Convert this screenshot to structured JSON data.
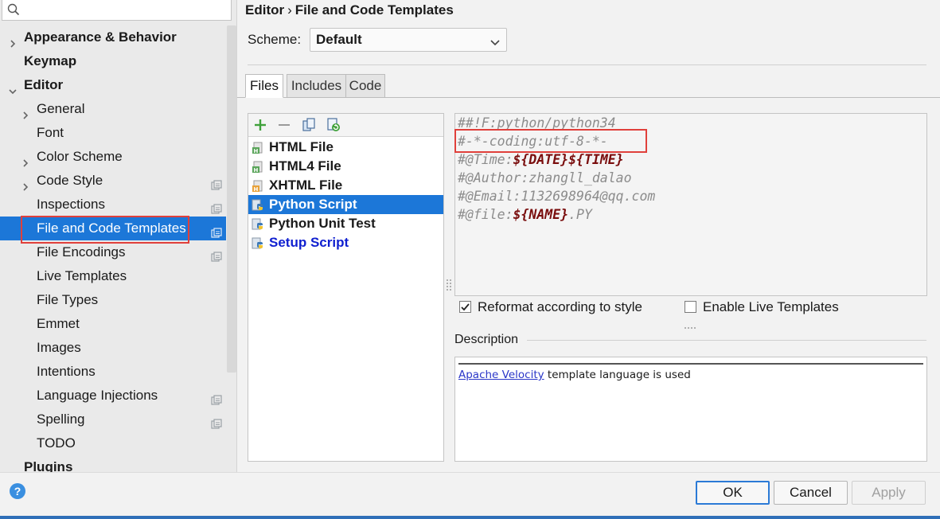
{
  "search": {
    "placeholder": ""
  },
  "sidebar": {
    "items": [
      {
        "label": "Appearance & Behavior",
        "level": 0,
        "bold": true,
        "expand": "collapsed",
        "scope": false
      },
      {
        "label": "Keymap",
        "level": 0,
        "bold": true,
        "expand": "none",
        "scope": false
      },
      {
        "label": "Editor",
        "level": 0,
        "bold": true,
        "expand": "expanded",
        "scope": false
      },
      {
        "label": "General",
        "level": 1,
        "bold": false,
        "expand": "collapsed",
        "scope": false
      },
      {
        "label": "Font",
        "level": 1,
        "bold": false,
        "expand": "none",
        "scope": false
      },
      {
        "label": "Color Scheme",
        "level": 1,
        "bold": false,
        "expand": "collapsed",
        "scope": false
      },
      {
        "label": "Code Style",
        "level": 1,
        "bold": false,
        "expand": "collapsed",
        "scope": true
      },
      {
        "label": "Inspections",
        "level": 1,
        "bold": false,
        "expand": "none",
        "scope": true
      },
      {
        "label": "File and Code Templates",
        "level": 1,
        "bold": false,
        "expand": "none",
        "scope": true,
        "selected": true
      },
      {
        "label": "File Encodings",
        "level": 1,
        "bold": false,
        "expand": "none",
        "scope": true
      },
      {
        "label": "Live Templates",
        "level": 1,
        "bold": false,
        "expand": "none",
        "scope": false
      },
      {
        "label": "File Types",
        "level": 1,
        "bold": false,
        "expand": "none",
        "scope": false
      },
      {
        "label": "Emmet",
        "level": 1,
        "bold": false,
        "expand": "none",
        "scope": false
      },
      {
        "label": "Images",
        "level": 1,
        "bold": false,
        "expand": "none",
        "scope": false
      },
      {
        "label": "Intentions",
        "level": 1,
        "bold": false,
        "expand": "none",
        "scope": false
      },
      {
        "label": "Language Injections",
        "level": 1,
        "bold": false,
        "expand": "none",
        "scope": true
      },
      {
        "label": "Spelling",
        "level": 1,
        "bold": false,
        "expand": "none",
        "scope": true
      },
      {
        "label": "TODO",
        "level": 1,
        "bold": false,
        "expand": "none",
        "scope": false
      },
      {
        "label": "Plugins",
        "level": 0,
        "bold": true,
        "expand": "none",
        "scope": false
      }
    ]
  },
  "header": {
    "breadcrumb_parent": "Editor",
    "breadcrumb_sep": "›",
    "breadcrumb_current": "File and Code Templates"
  },
  "scheme": {
    "label": "Scheme:",
    "value": "Default"
  },
  "tabs": [
    {
      "label": "Files",
      "active": true
    },
    {
      "label": "Includes",
      "active": false
    },
    {
      "label": "Code",
      "active": false
    }
  ],
  "file_list": {
    "items": [
      {
        "name": "HTML File",
        "icon": "html-file-icon",
        "selected": false,
        "custom": false
      },
      {
        "name": "HTML4 File",
        "icon": "html-file-icon",
        "selected": false,
        "custom": false
      },
      {
        "name": "XHTML File",
        "icon": "xhtml-file-icon",
        "selected": false,
        "custom": false
      },
      {
        "name": "Python Script",
        "icon": "python-file-icon",
        "selected": true,
        "custom": false
      },
      {
        "name": "Python Unit Test",
        "icon": "python-file-icon",
        "selected": false,
        "custom": false
      },
      {
        "name": "Setup Script",
        "icon": "python-file-icon",
        "selected": false,
        "custom": true
      }
    ]
  },
  "editor": {
    "lines": [
      [
        {
          "t": "##!F:python/python34",
          "v": false
        }
      ],
      [
        {
          "t": "#-*-coding:utf-8-*-",
          "v": false
        }
      ],
      [
        {
          "t": "#@Time:",
          "v": false
        },
        {
          "t": "${DATE}${TIME}",
          "v": true
        }
      ],
      [
        {
          "t": "#@Author:zhangll_dalao",
          "v": false
        }
      ],
      [
        {
          "t": "#@Email:1132698964@qq.com",
          "v": false
        }
      ],
      [
        {
          "t": "#@file:",
          "v": false
        },
        {
          "t": "${NAME}",
          "v": true
        },
        {
          "t": ".PY",
          "v": false
        }
      ]
    ]
  },
  "options": {
    "reformat_label": "Reformat according to style",
    "reformat_checked": true,
    "live_templates_label": "Enable Live Templates",
    "live_templates_checked": false
  },
  "description": {
    "label": "Description",
    "link_text": "Apache Velocity",
    "text": " template language is used"
  },
  "buttons": {
    "ok": "OK",
    "cancel": "Cancel",
    "apply": "Apply"
  },
  "help": {
    "label": "?"
  },
  "colors": {
    "selection": "#1c77d8",
    "highlight_box": "#e0403b",
    "template_variable": "#7a0e0e",
    "custom_template": "#1020d0",
    "link": "#2a36c8"
  }
}
